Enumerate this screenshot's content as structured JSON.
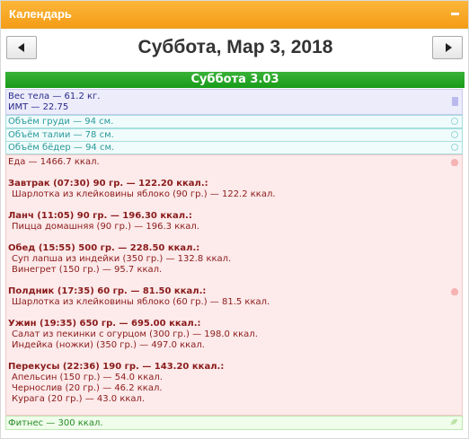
{
  "window": {
    "title": "Календарь"
  },
  "nav": {
    "prev_label": "◄",
    "next_label": "►",
    "date_title": "Суббота, Мар 3, 2018"
  },
  "day": {
    "header": "Суббота 3.03"
  },
  "weight": {
    "line1": "Вес тела — 61.2 кг.",
    "line2": "ИМТ — 22.75"
  },
  "measurements": [
    "Объём груди — 94 см.",
    "Объём талии — 78 см.",
    "Объём бёдер — 94 см."
  ],
  "food": {
    "total": "Еда — 1466.7 ккал.",
    "meals": [
      {
        "header": "Завтрак (07:30) 90 гр. — 122.20 ккал.:",
        "items": [
          "Шарлотка из клейковины яблоко (90 гр.) — 122.2 ккал."
        ]
      },
      {
        "header": "Ланч (11:05) 90 гр. — 196.30 ккал.:",
        "items": [
          "Пицца домашняя (90 гр.) — 196.3 ккал."
        ]
      },
      {
        "header": "Обед (15:55) 500 гр. — 228.50 ккал.:",
        "items": [
          "Суп лапша из индейки (350 гр.) — 132.8 ккал.",
          "Винегрет (150 гр.) — 95.7 ккал."
        ]
      },
      {
        "header": "Полдник (17:35) 60 гр. — 81.50 ккал.:",
        "items": [
          "Шарлотка из клейковины яблоко (60 гр.) — 81.5 ккал."
        ]
      },
      {
        "header": "Ужин (19:35) 650 гр. — 695.00 ккал.:",
        "items": [
          "Салат из пекинки с огурцом (300 гр.) — 198.0 ккал.",
          "Индейка (ножки) (350 гр.) — 497.0 ккал."
        ]
      },
      {
        "header": "Перекусы (22:36) 190 гр. — 143.20 ккал.:",
        "items": [
          "Апельсин (150 гр.) — 54.0 ккал.",
          "Чернослив (20 гр.) — 46.2 ккал.",
          "Курага (20 гр.) — 43.0 ккал."
        ]
      }
    ]
  },
  "fitness": {
    "text": "Фитнес — 300 ккал."
  },
  "icons": {
    "collapse": "minus-icon",
    "weight": "scale-icon",
    "measure": "tape-icon",
    "food": "apple-icon",
    "fitness": "leaf-icon"
  }
}
